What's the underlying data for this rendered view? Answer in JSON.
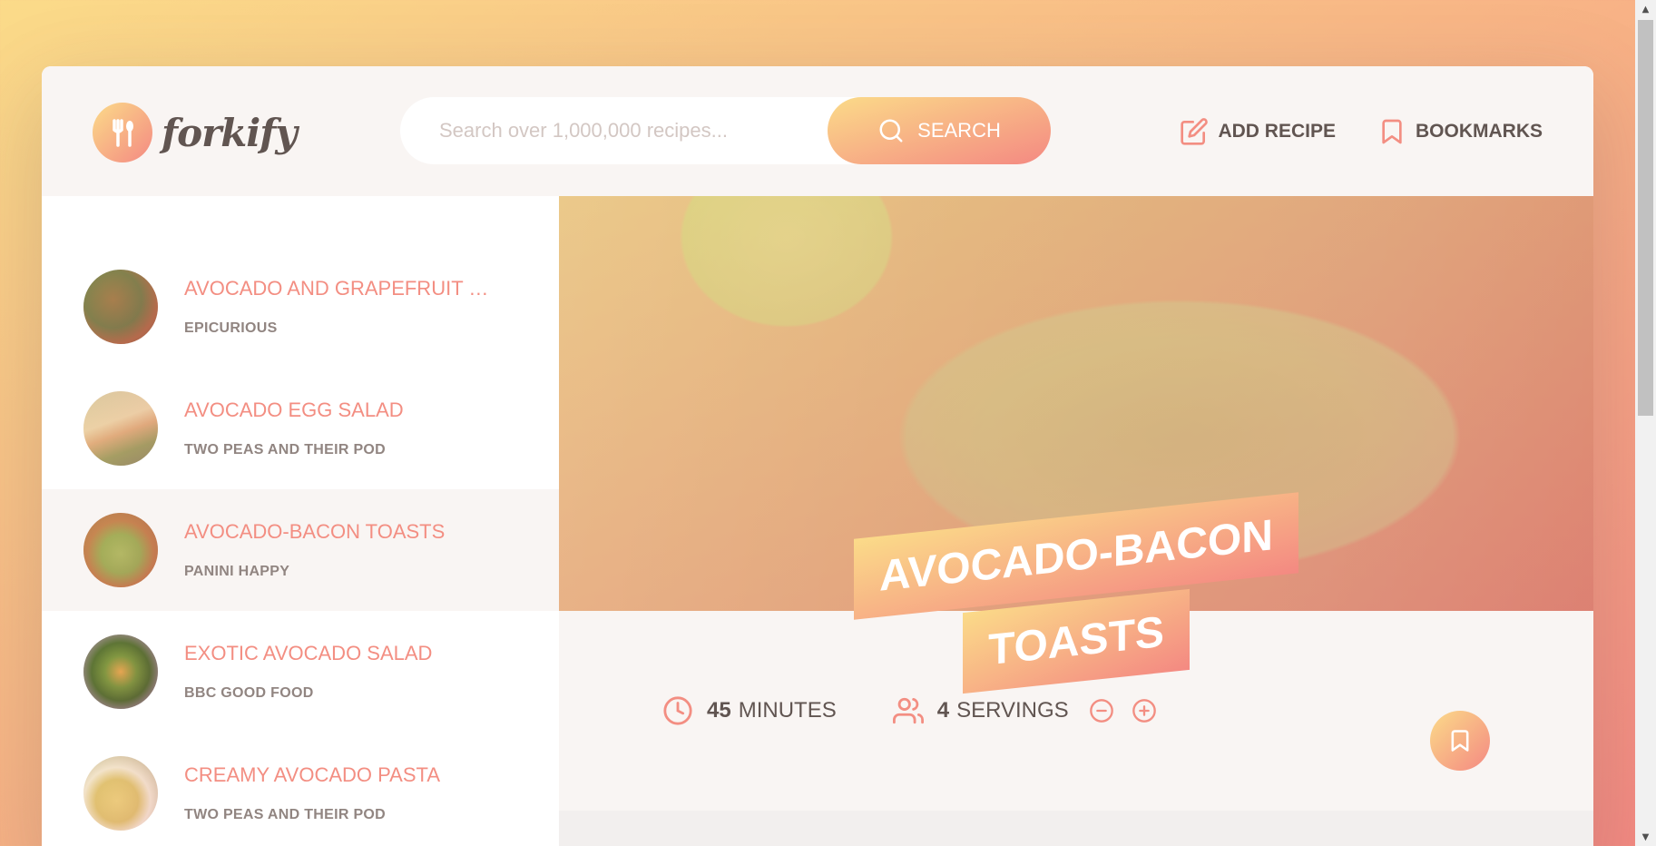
{
  "header": {
    "logo_text": "forkify",
    "search": {
      "placeholder": "Search over 1,000,000 recipes...",
      "button_label": "SEARCH"
    },
    "nav": {
      "add_recipe": "ADD RECIPE",
      "bookmarks": "BOOKMARKS"
    }
  },
  "results": [
    {
      "title": "AVOCADO AND GRAPEFRUIT SAL...",
      "publisher": "EPICURIOUS",
      "active": false
    },
    {
      "title": "AVOCADO EGG SALAD",
      "publisher": "TWO PEAS AND THEIR POD",
      "active": false
    },
    {
      "title": "AVOCADO-BACON TOASTS",
      "publisher": "PANINI HAPPY",
      "active": true
    },
    {
      "title": "EXOTIC AVOCADO SALAD",
      "publisher": "BBC GOOD FOOD",
      "active": false
    },
    {
      "title": "CREAMY AVOCADO PASTA",
      "publisher": "TWO PEAS AND THEIR POD",
      "active": false
    }
  ],
  "recipe": {
    "title_line1": "AVOCADO-BACON",
    "title_line2": "TOASTS",
    "minutes": "45",
    "minutes_label": "MINUTES",
    "servings": "4",
    "servings_label": "SERVINGS"
  },
  "colors": {
    "accent_start": "#fbdb89",
    "accent_end": "#f48982",
    "text": "#615551",
    "result_title": "#f38e82"
  },
  "icons": [
    "fork-spoon-icon",
    "search-icon",
    "edit-icon",
    "bookmark-icon",
    "clock-icon",
    "users-icon",
    "minus-circle-icon",
    "plus-circle-icon"
  ]
}
